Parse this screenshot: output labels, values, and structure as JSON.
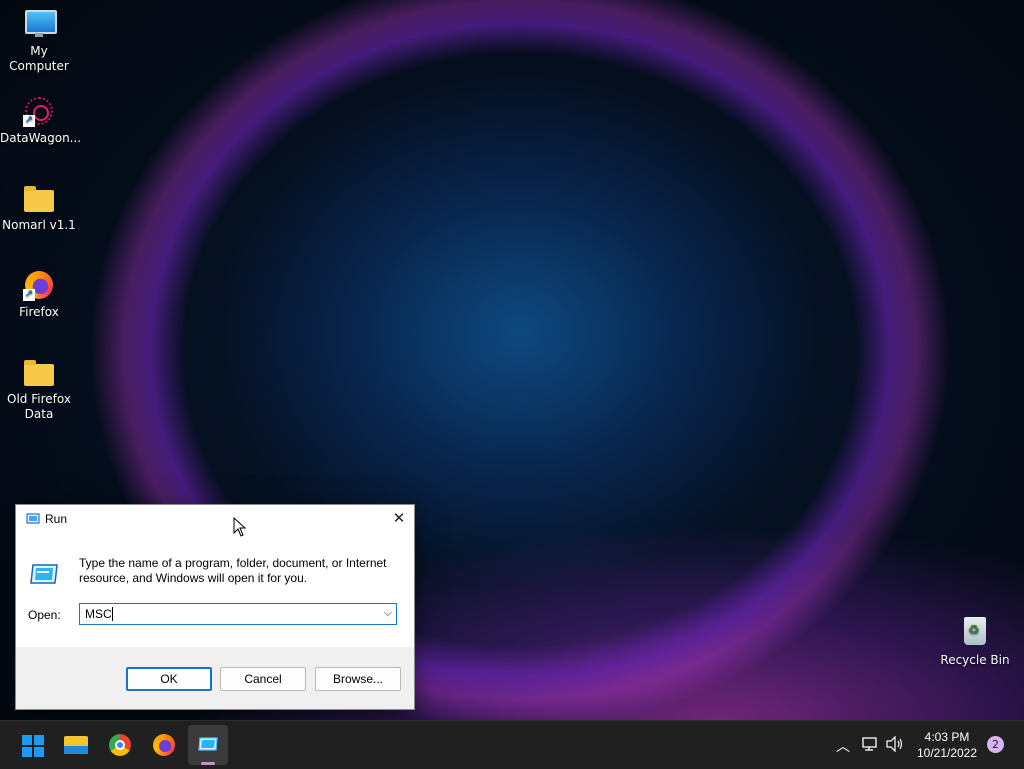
{
  "desktop": {
    "icons": [
      {
        "label": "My Computer",
        "icon": "computer-icon"
      },
      {
        "label": "DataWagon...",
        "icon": "datawagon-icon"
      },
      {
        "label": "Nomarl v1.1",
        "icon": "folder-icon"
      },
      {
        "label": "Firefox",
        "icon": "firefox-icon"
      },
      {
        "label": "Old Firefox Data",
        "icon": "folder-icon"
      }
    ],
    "recycle_bin": {
      "label": "Recycle Bin",
      "icon": "recycle-bin-icon"
    }
  },
  "run_dialog": {
    "title": "Run",
    "description": "Type the name of a program, folder, document, or Internet resource, and Windows will open it for you.",
    "open_label": "Open:",
    "open_value": "MSC",
    "buttons": {
      "ok": "OK",
      "cancel": "Cancel",
      "browse": "Browse..."
    }
  },
  "taskbar": {
    "apps": [
      "start",
      "file-explorer",
      "chrome",
      "firefox",
      "run"
    ],
    "active_app": "run",
    "clock": {
      "time": "4:03 PM",
      "date": "10/21/2022"
    },
    "notification_count": "2"
  },
  "colors": {
    "accent": "#1a73c8",
    "taskbar": "#202020"
  }
}
